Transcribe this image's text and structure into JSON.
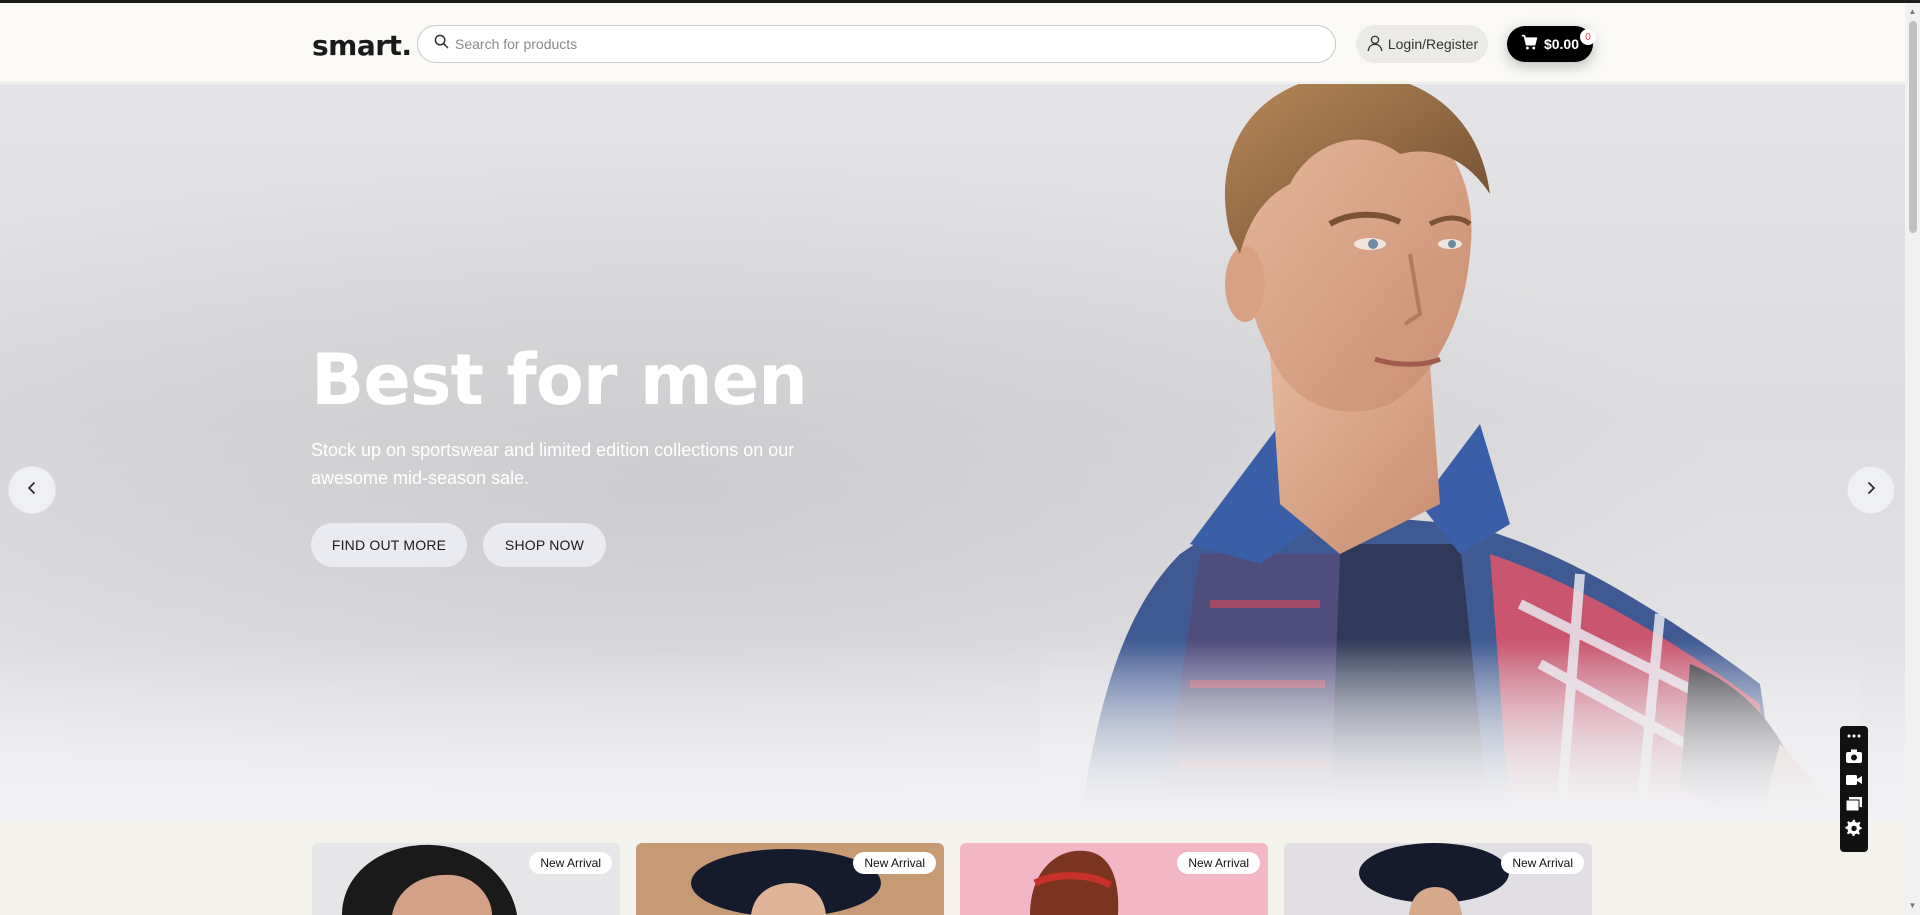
{
  "header": {
    "logo": "smart.",
    "search_placeholder": "Search for products",
    "login_label": "Login/Register",
    "cart_total": "$0.00",
    "cart_count": "0"
  },
  "hero": {
    "title": "Best for men",
    "subtitle": "Stock up on sportswear and limited edition collections on our awesome mid-season sale.",
    "buttons": {
      "find_out_more": "FIND OUT MORE",
      "shop_now": "SHOP NOW"
    }
  },
  "products": [
    {
      "tag": "New Arrival"
    },
    {
      "tag": "New Arrival"
    },
    {
      "tag": "New Arrival"
    },
    {
      "tag": "New Arrival"
    }
  ],
  "icons": {
    "search": "search-icon",
    "user": "user-icon",
    "cart": "cart-icon",
    "prev": "chevron-left-icon",
    "next": "chevron-right-icon"
  },
  "colors": {
    "cart_button": "#000000",
    "cart_badge_text": "#e2402d",
    "hero_button": "#e9ebf0"
  }
}
